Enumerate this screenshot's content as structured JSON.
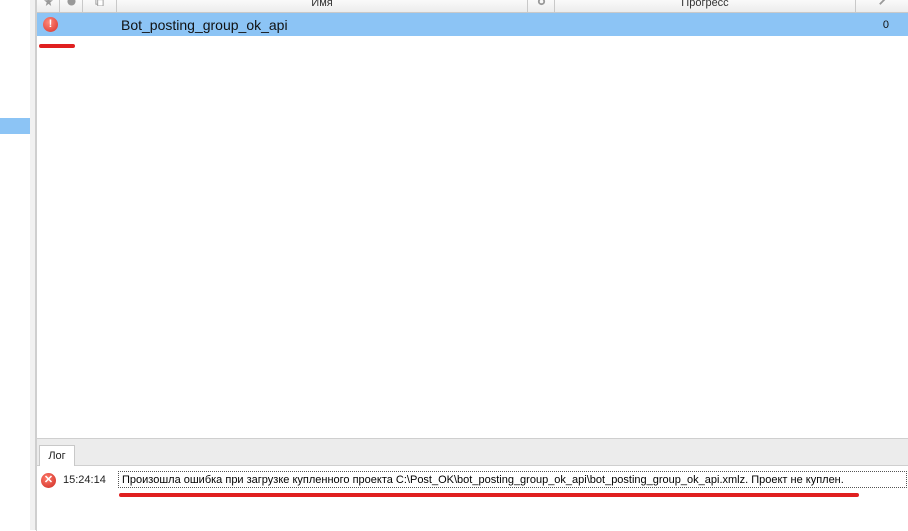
{
  "grid": {
    "columns": [
      {
        "label": "",
        "icon": "star-icon"
      },
      {
        "label": "",
        "icon": "globe-icon"
      },
      {
        "label": "",
        "icon": "copy-icon"
      },
      {
        "label": "Имя"
      },
      {
        "label": "",
        "icon": "gear-icon"
      },
      {
        "label": "Прогресс"
      },
      {
        "label": "",
        "icon": "pin-icon"
      }
    ],
    "rows": [
      {
        "status_icon": "error-icon",
        "name": "Bot_posting_group_ok_api",
        "count": "0"
      }
    ]
  },
  "log": {
    "tab_label": "Лог",
    "entries": [
      {
        "icon": "error-icon",
        "time": "15:24:14",
        "message": "Произошла ошибка при загрузке купленного проекта C:\\Post_OK\\bot_posting_group_ok_api\\bot_posting_group_ok_api.xmlz. Проект не куплен."
      }
    ]
  },
  "colors": {
    "selection": "#8cc4f5",
    "annotation_red": "#e02020"
  }
}
